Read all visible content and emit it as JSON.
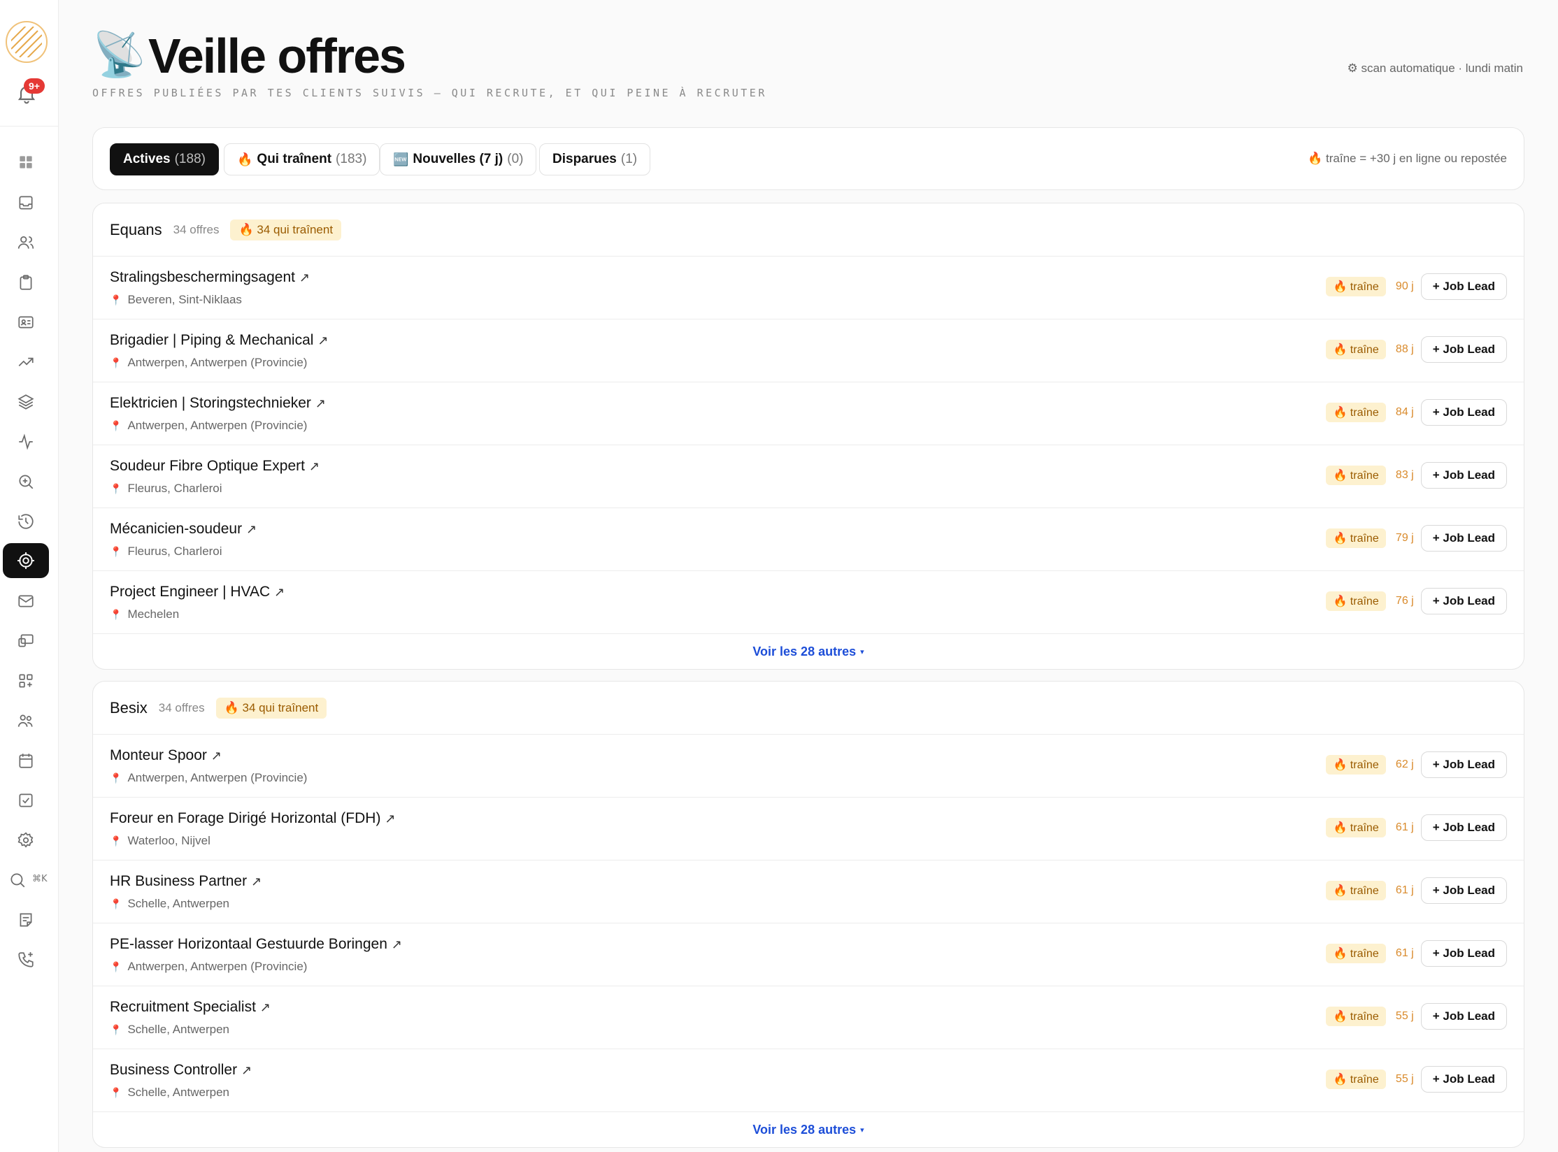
{
  "sidebar": {
    "notification_badge": "9+",
    "search_shortcut": "⌘K",
    "nav_icons": [
      "grid-icon",
      "inbox-icon",
      "users-icon",
      "clipboard-icon",
      "contact-card-icon",
      "trending-icon",
      "layers-icon",
      "activity-icon",
      "search-zoom-icon",
      "history-icon",
      "target-icon",
      "mail-icon",
      "devices-icon",
      "apps-add-icon",
      "team-icon",
      "calendar-icon",
      "checkbox-icon",
      "settings-icon",
      "search-icon",
      "note-icon",
      "phone-add-icon"
    ],
    "active_item": "target-icon"
  },
  "header": {
    "icon": "📡",
    "title": "Veille offres",
    "subtitle": "OFFRES PUBLIÉES PAR TES CLIENTS SUIVIS — QUI RECRUTE, ET QUI PEINE À RECRUTER",
    "scan_info": "⚙ scan automatique · lundi matin"
  },
  "filters": {
    "tabs": [
      {
        "label": "Actives",
        "count": "(188)",
        "icon": ""
      },
      {
        "label": "Qui traînent",
        "count": "(183)",
        "icon": "🔥"
      },
      {
        "label": "Nouvelles (7 j)",
        "count": "(0)",
        "icon": "🆕"
      },
      {
        "label": "Disparues",
        "count": "(1)",
        "icon": ""
      }
    ],
    "active_tab": "Actives",
    "legend": "🔥 traîne = +30 j en ligne ou repostée"
  },
  "clients": [
    {
      "name": "Equans",
      "offers": "34 offres",
      "stale": "🔥 34 qui traînent",
      "more": "Voir les 28 autres",
      "jobs": [
        {
          "title": "Stralingsbeschermingsagent",
          "location": "Beveren, Sint-Niklaas",
          "badge": "🔥 traîne",
          "days": "90 j"
        },
        {
          "title": "Brigadier | Piping & Mechanical",
          "location": "Antwerpen, Antwerpen (Provincie)",
          "badge": "🔥 traîne",
          "days": "88 j"
        },
        {
          "title": "Elektricien | Storingstechnieker",
          "location": "Antwerpen, Antwerpen (Provincie)",
          "badge": "🔥 traîne",
          "days": "84 j"
        },
        {
          "title": "Soudeur Fibre Optique Expert",
          "location": "Fleurus, Charleroi",
          "badge": "🔥 traîne",
          "days": "83 j"
        },
        {
          "title": "Mécanicien-soudeur",
          "location": "Fleurus, Charleroi",
          "badge": "🔥 traîne",
          "days": "79 j"
        },
        {
          "title": "Project Engineer | HVAC",
          "location": "Mechelen",
          "badge": "🔥 traîne",
          "days": "76 j"
        }
      ]
    },
    {
      "name": "Besix",
      "offers": "34 offres",
      "stale": "🔥 34 qui traînent",
      "more": "Voir les 28 autres",
      "jobs": [
        {
          "title": "Monteur Spoor",
          "location": "Antwerpen, Antwerpen (Provincie)",
          "badge": "🔥 traîne",
          "days": "62 j"
        },
        {
          "title": "Foreur en Forage Dirigé Horizontal (FDH)",
          "location": "Waterloo, Nijvel",
          "badge": "🔥 traîne",
          "days": "61 j"
        },
        {
          "title": "HR Business Partner",
          "location": "Schelle, Antwerpen",
          "badge": "🔥 traîne",
          "days": "61 j"
        },
        {
          "title": "PE-lasser Horizontaal Gestuurde Boringen",
          "location": "Antwerpen, Antwerpen (Provincie)",
          "badge": "🔥 traîne",
          "days": "61 j"
        },
        {
          "title": "Recruitment Specialist",
          "location": "Schelle, Antwerpen",
          "badge": "🔥 traîne",
          "days": "55 j"
        },
        {
          "title": "Business Controller",
          "location": "Schelle, Antwerpen",
          "badge": "🔥 traîne",
          "days": "55 j"
        }
      ]
    }
  ],
  "actions": {
    "job_lead_label": "+ Job Lead",
    "external_link_glyph": "↗",
    "pin_glyph": "📍",
    "caret_glyph": "▾"
  },
  "colors": {
    "accent_link": "#1d4ed8",
    "stale_bg": "#fdf1cf",
    "stale_text": "#9a5b00",
    "days_text": "#d98a2b",
    "active_nav": "#111111",
    "badge_red": "#e53935",
    "logo_ring": "#f0c27a"
  }
}
